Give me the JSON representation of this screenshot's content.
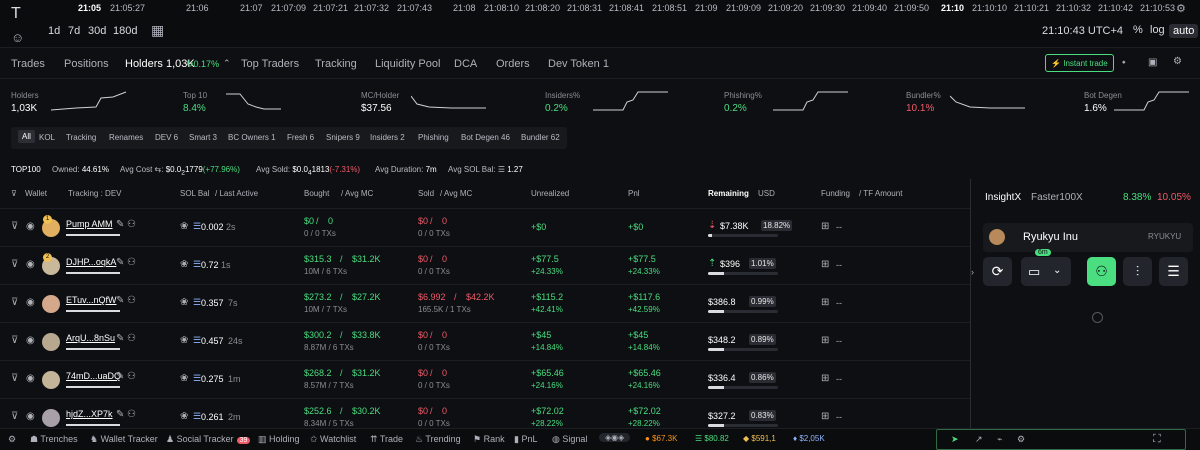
{
  "timeline": {
    "ticks": [
      {
        "label": "21:05",
        "bold": true
      },
      {
        "label": "21:05:27"
      },
      {
        "label": "21:06"
      },
      {
        "label": "21:07"
      },
      {
        "label": "21:07:09"
      },
      {
        "label": "21:07:21"
      },
      {
        "label": "21:07:32"
      },
      {
        "label": "21:07:43"
      },
      {
        "label": "21:08"
      },
      {
        "label": "21:08:10"
      },
      {
        "label": "21:08:20"
      },
      {
        "label": "21:08:31"
      },
      {
        "label": "21:08:41"
      },
      {
        "label": "21:08:51"
      },
      {
        "label": "21:09"
      },
      {
        "label": "21:09:09"
      },
      {
        "label": "21:09:20"
      },
      {
        "label": "21:09:30"
      },
      {
        "label": "21:09:40"
      },
      {
        "label": "21:09:50"
      },
      {
        "label": "21:10",
        "bold": true
      },
      {
        "label": "21:10:10"
      },
      {
        "label": "21:10:21"
      },
      {
        "label": "21:10:32"
      },
      {
        "label": "21:10:42"
      },
      {
        "label": "21:10:53"
      }
    ],
    "timeframes": [
      "1d",
      "7d",
      "30d",
      "180d"
    ],
    "clock": "21:10:43 UTC+4",
    "scale_buttons": [
      "%",
      "log",
      "auto"
    ],
    "active_scale": "auto"
  },
  "tabs": {
    "items": [
      "Trades",
      "Positions",
      "Holders 1,03K",
      "Top Traders",
      "Tracking",
      "Liquidity Pool",
      "DCA",
      "Orders",
      "Dev Token 1"
    ],
    "holders_pct": "0.17%",
    "instant_trade": "Instant trade"
  },
  "stats": [
    {
      "label": "Holders",
      "value": "1,03K",
      "color": "#ffffff"
    },
    {
      "label": "Top 10",
      "value": "8.4%",
      "color": "#4ade80"
    },
    {
      "label": "MC/Holder",
      "value": "$37.56",
      "color": "#ffffff"
    },
    {
      "label": "Insiders%",
      "value": "0.2%",
      "color": "#4ade80"
    },
    {
      "label": "Phishing%",
      "value": "0.2%",
      "color": "#4ade80"
    },
    {
      "label": "Bundler%",
      "value": "10.1%",
      "color": "#f05a6a"
    },
    {
      "label": "Bot Degen",
      "value": "1.6%",
      "color": "#ffffff"
    }
  ],
  "filters": [
    "All",
    "KOL",
    "Tracking",
    "Renames",
    "DEV 6",
    "Smart 3",
    "BC Owners 1",
    "Fresh 6",
    "Snipers 9",
    "Insiders 2",
    "Phishing",
    "Bot Degen 46",
    "Bundler 62"
  ],
  "summary": {
    "top": "TOP100",
    "owned_label": "Owned:",
    "owned": "44.61%",
    "avg_cost_label": "Avg Cost",
    "avg_cost": "$0.0",
    "avg_cost_sub": "2",
    "avg_cost_rest": "1779",
    "avg_cost_pct": "(+77.96%)",
    "avg_sold_label": "Avg Sold:",
    "avg_sold": "$0.0",
    "avg_sold_sub": "4",
    "avg_sold_rest": "1813",
    "avg_sold_pct": "(-7.31%)",
    "avg_dur_label": "Avg Duration:",
    "avg_dur": "7m",
    "avg_sol_label": "Avg SOL Bal:",
    "avg_sol": "1.27"
  },
  "headers": {
    "wallet": "Wallet",
    "tracking": "Tracking : DEV",
    "sol_bal": "SOL Bal",
    "last_active": "/ Last Active",
    "bought": "Bought",
    "avg_mc1": "/ Avg MC",
    "sold": "Sold",
    "avg_mc2": "/ Avg MC",
    "unrealized": "Unrealized",
    "pnl": "Pnl",
    "remaining": "Remaining",
    "usd": "USD",
    "funding": "Funding",
    "tf_amount": "/ TF Amount"
  },
  "rows": [
    {
      "rank": "1",
      "name": "Pump AMM",
      "sol": "0.002",
      "age": "2s",
      "bought": "$0",
      "bought_mc": "0",
      "bought_sub": "0 / 0 TXs",
      "sold": "$0",
      "sold_mc": "0",
      "sold_sub": "0 / 0 TXs",
      "unreal": "+$0",
      "unreal_pct": "",
      "pnl": "+$0",
      "pnl_pct": "",
      "remaining": "$7.38K",
      "rem_pct": "18.82%",
      "rem_frac": 0.25,
      "funding": "--"
    },
    {
      "rank": "2",
      "name": "DJHP...oqkA",
      "sol": "0.72",
      "age": "1s",
      "bought": "$315.3",
      "bought_mc": "$31.2K",
      "bought_sub": "10M / 6 TXs",
      "sold": "$0",
      "sold_mc": "0",
      "sold_sub": "0 / 0 TXs",
      "unreal": "+$77.5",
      "unreal_pct": "+24.33%",
      "pnl": "+$77.5",
      "pnl_pct": "+24.33%",
      "remaining": "$396",
      "rem_pct": "1.01%",
      "rem_frac": 1.0,
      "funding": "--"
    },
    {
      "rank": "",
      "name": "ETuv...nQfW",
      "sol": "0.357",
      "age": "7s",
      "bought": "$273.2",
      "bought_mc": "$27.2K",
      "bought_sub": "10M / 7 TXs",
      "sold": "$6.992",
      "sold_mc": "$42.2K",
      "sold_sub": "165.5K / 1 TXs",
      "unreal": "+$115.2",
      "unreal_pct": "+42.41%",
      "pnl": "+$117.6",
      "pnl_pct": "+42.59%",
      "remaining": "$386.8",
      "rem_pct": "0.99%",
      "rem_frac": 1.0,
      "funding": "--"
    },
    {
      "rank": "",
      "name": "ArqU...8nSu",
      "sol": "0.457",
      "age": "24s",
      "bought": "$300.2",
      "bought_mc": "$33.8K",
      "bought_sub": "8.87M / 6 TXs",
      "sold": "$0",
      "sold_mc": "0",
      "sold_sub": "0 / 0 TXs",
      "unreal": "+$45",
      "unreal_pct": "+14.84%",
      "pnl": "+$45",
      "pnl_pct": "+14.84%",
      "remaining": "$348.2",
      "rem_pct": "0.89%",
      "rem_frac": 1.0,
      "funding": "--"
    },
    {
      "rank": "",
      "name": "74mD...uaDQ",
      "sol": "0.275",
      "age": "1m",
      "bought": "$268.2",
      "bought_mc": "$31.2K",
      "bought_sub": "8.57M / 7 TXs",
      "sold": "$0",
      "sold_mc": "0",
      "sold_sub": "0 / 0 TXs",
      "unreal": "+$65.46",
      "unreal_pct": "+24.16%",
      "pnl": "+$65.46",
      "pnl_pct": "+24.16%",
      "remaining": "$336.4",
      "rem_pct": "0.86%",
      "rem_frac": 1.0,
      "funding": "--"
    },
    {
      "rank": "",
      "name": "hjdZ...XP7k",
      "sol": "0.261",
      "age": "2m",
      "bought": "$252.6",
      "bought_mc": "$30.2K",
      "bought_sub": "8.34M / 5 TXs",
      "sold": "$0",
      "sold_mc": "0",
      "sold_sub": "0 / 0 TXs",
      "unreal": "+$72.02",
      "unreal_pct": "+28.22%",
      "pnl": "+$72.02",
      "pnl_pct": "+28.22%",
      "remaining": "$327.2",
      "rem_pct": "0.83%",
      "rem_frac": 1.0,
      "funding": "--"
    }
  ],
  "right_panel": {
    "tab1": "InsightX",
    "tab2": "Faster100X",
    "pct1": "8.38%",
    "pct2": "10.05%",
    "token_name": "Ryukyu Inu",
    "token_symbol": "RYUKYU",
    "badge": "6m"
  },
  "footer": {
    "items": [
      "Trenches",
      "Wallet Tracker",
      "Social Tracker",
      "Holding",
      "Watchlist",
      "Trade",
      "Trending",
      "Rank",
      "PnL",
      "Signal"
    ],
    "social_badge": "39",
    "prices": [
      "$67.3K",
      "$80.82",
      "$591,1",
      "$2,05K"
    ]
  },
  "colors": {
    "accent": "#4ade80",
    "negative": "#f05a6a",
    "background": "#0e0f12"
  }
}
